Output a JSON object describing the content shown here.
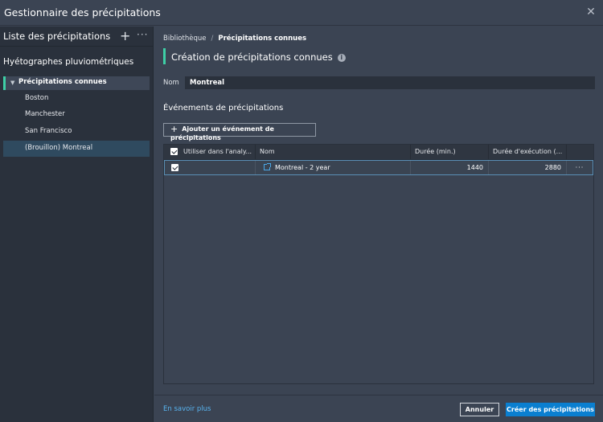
{
  "window": {
    "title": "Gestionnaire des précipitations",
    "close_icon": "close-icon"
  },
  "sidebar": {
    "header": "Liste des précipitations",
    "add_icon": "plus-icon",
    "more_icon": "more-icon",
    "section_title": "Hyétographes pluviométriques",
    "group": {
      "label": "Précipitations connues",
      "expanded": true
    },
    "items": [
      {
        "label": "Boston"
      },
      {
        "label": "Manchester"
      },
      {
        "label": "San Francisco"
      },
      {
        "label": "(Brouillon) Montreal",
        "selected": true
      }
    ]
  },
  "main": {
    "breadcrumb": {
      "root": "Bibliothèque",
      "separator": "/",
      "current": "Précipitations connues"
    },
    "heading": "Création de précipitations connues",
    "name_label": "Nom",
    "name_value": "Montreal",
    "events_title": "Événements de précipitations",
    "add_event_label": "Ajouter un événement de précipitations",
    "table": {
      "headers": [
        "Utiliser dans l'analy...",
        "Nom",
        "Durée (min.)",
        "Durée d'exécution (..."
      ],
      "rows": [
        {
          "use": true,
          "name": "Montreal - 2 year",
          "duration": "1440",
          "run_duration": "2880"
        }
      ]
    },
    "footer": {
      "learn_more": "En savoir plus",
      "cancel": "Annuler",
      "create": "Créer des précipitations"
    }
  },
  "colors": {
    "accent": "#3ecfa6",
    "primary_button": "#0a7fd0",
    "link": "#58b4f0",
    "selection": "#2f4a5f"
  }
}
